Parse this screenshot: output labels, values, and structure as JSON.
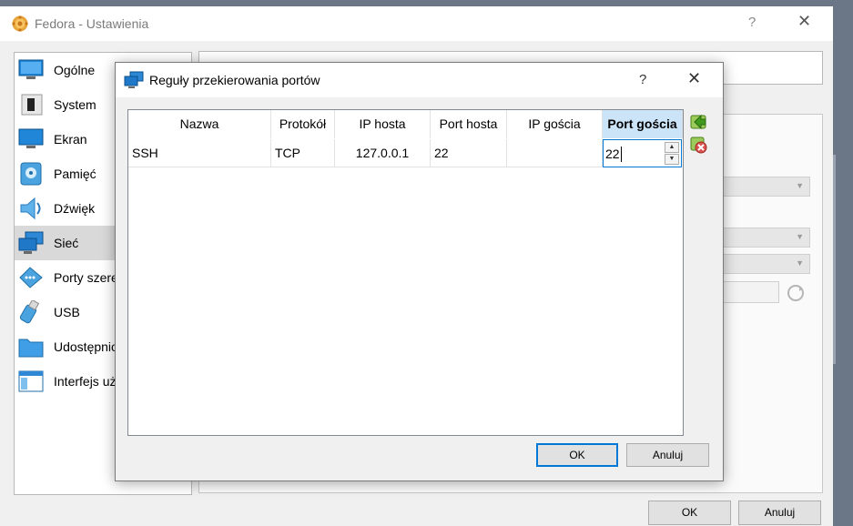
{
  "window": {
    "title": "Fedora - Ustawienia",
    "help_glyph": "?",
    "close_glyph": "✕",
    "ok_label": "OK",
    "cancel_label": "Anuluj"
  },
  "sidebar": {
    "items": [
      {
        "label": "Ogólne",
        "icon": "monitor-icon"
      },
      {
        "label": "System",
        "icon": "chip-icon"
      },
      {
        "label": "Ekran",
        "icon": "display-icon"
      },
      {
        "label": "Pamięć",
        "icon": "disk-icon"
      },
      {
        "label": "Dźwięk",
        "icon": "speaker-icon"
      },
      {
        "label": "Sieć",
        "icon": "network-icon",
        "selected": true
      },
      {
        "label": "Porty szeregowe",
        "icon": "serial-port-icon"
      },
      {
        "label": "USB",
        "icon": "usb-icon"
      },
      {
        "label": "Udostępnione foldery",
        "icon": "folder-icon"
      },
      {
        "label": "Interfejs użytkownika",
        "icon": "ui-window-icon"
      }
    ]
  },
  "dialog": {
    "title": "Reguły przekierowania portów",
    "help_glyph": "?",
    "close_glyph": "✕",
    "columns": [
      "Nazwa",
      "Protokół",
      "IP hosta",
      "Port hosta",
      "IP gościa",
      "Port gościa"
    ],
    "rows": [
      {
        "name": "SSH",
        "protocol": "TCP",
        "host_ip": "127.0.0.1",
        "host_port": "22",
        "guest_ip": "",
        "guest_port": "22"
      }
    ],
    "spin_up": "▲",
    "spin_down": "▼",
    "ok_label": "OK",
    "cancel_label": "Anuluj"
  },
  "colors": {
    "selection_header": "#cce4f7",
    "focus_border": "#0078d7",
    "sidebar_selected": "#d9d9d9"
  }
}
